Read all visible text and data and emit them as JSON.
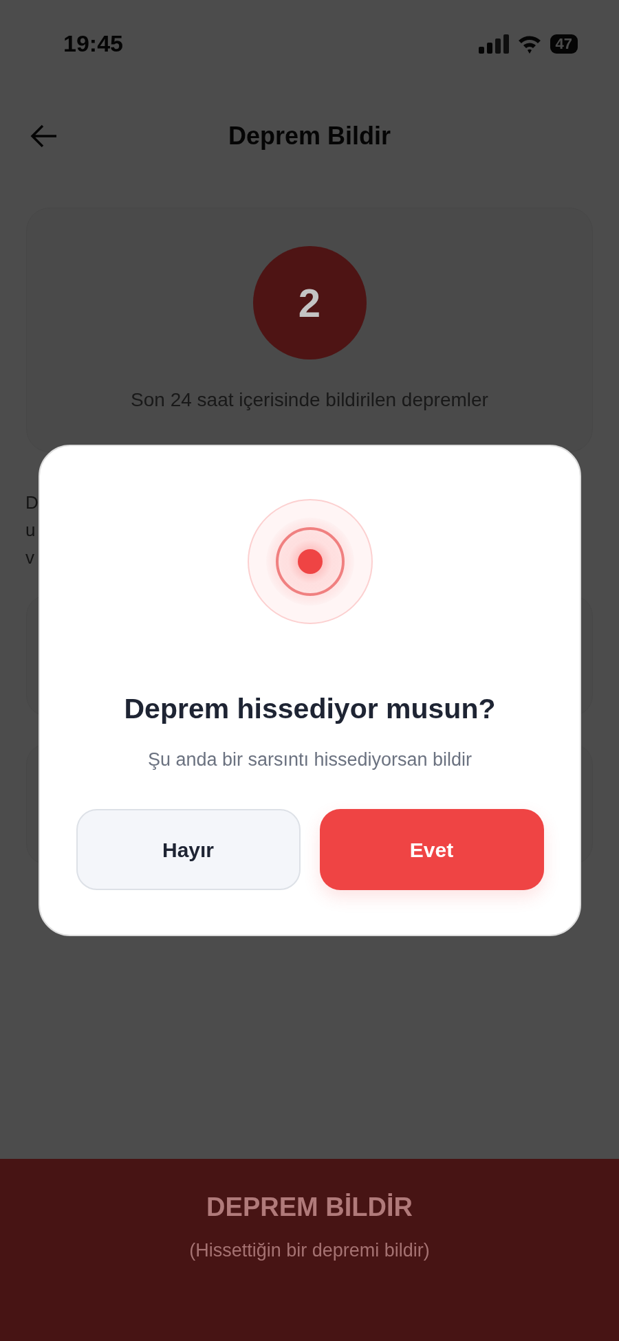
{
  "status_bar": {
    "time": "19:45",
    "battery": "47"
  },
  "header": {
    "title": "Deprem Bildir"
  },
  "summary": {
    "count": "2",
    "caption": "Son 24 saat içerisinde bildirilen depremler"
  },
  "description_peek": [
    "D",
    "u",
    "v"
  ],
  "modal": {
    "title": "Deprem hissediyor musun?",
    "subtitle": "Şu anda bir sarsıntı hissediyorsan bildir",
    "buttons": [
      {
        "label": "Hayır",
        "kind": "secondary"
      },
      {
        "label": "Evet",
        "kind": "primary"
      }
    ]
  },
  "bottom_action": {
    "title": "DEPREM BİLDİR",
    "subtitle": "(Hissettiğin bir depremi bildir)"
  }
}
